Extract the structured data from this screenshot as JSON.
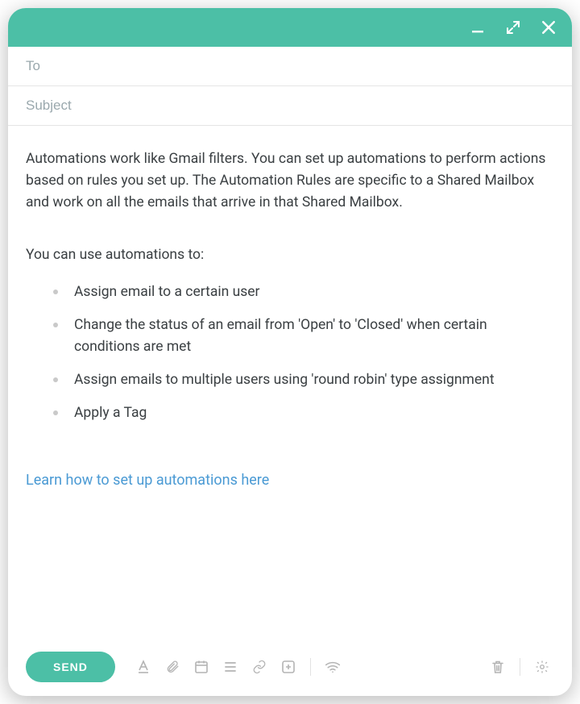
{
  "colors": {
    "accent": "#4cbfa6",
    "link": "#4a9ad4"
  },
  "fields": {
    "to_placeholder": "To",
    "to_value": "",
    "subject_placeholder": "Subject",
    "subject_value": ""
  },
  "body": {
    "intro": "Automations work like Gmail filters. You can set up automations to perform actions based on rules you set up. The Automation Rules are specific to a Shared Mailbox and work on all the emails that arrive in that Shared Mailbox.",
    "lead": "You can use automations to:",
    "bullets": [
      "Assign email to a certain user",
      "Change the status of an email from 'Open' to 'Closed' when certain conditions are met",
      "Assign emails to multiple users using 'round robin' type assignment",
      "Apply a Tag"
    ],
    "link_text": "Learn how to set up automations here"
  },
  "toolbar": {
    "send_label": "SEND"
  }
}
